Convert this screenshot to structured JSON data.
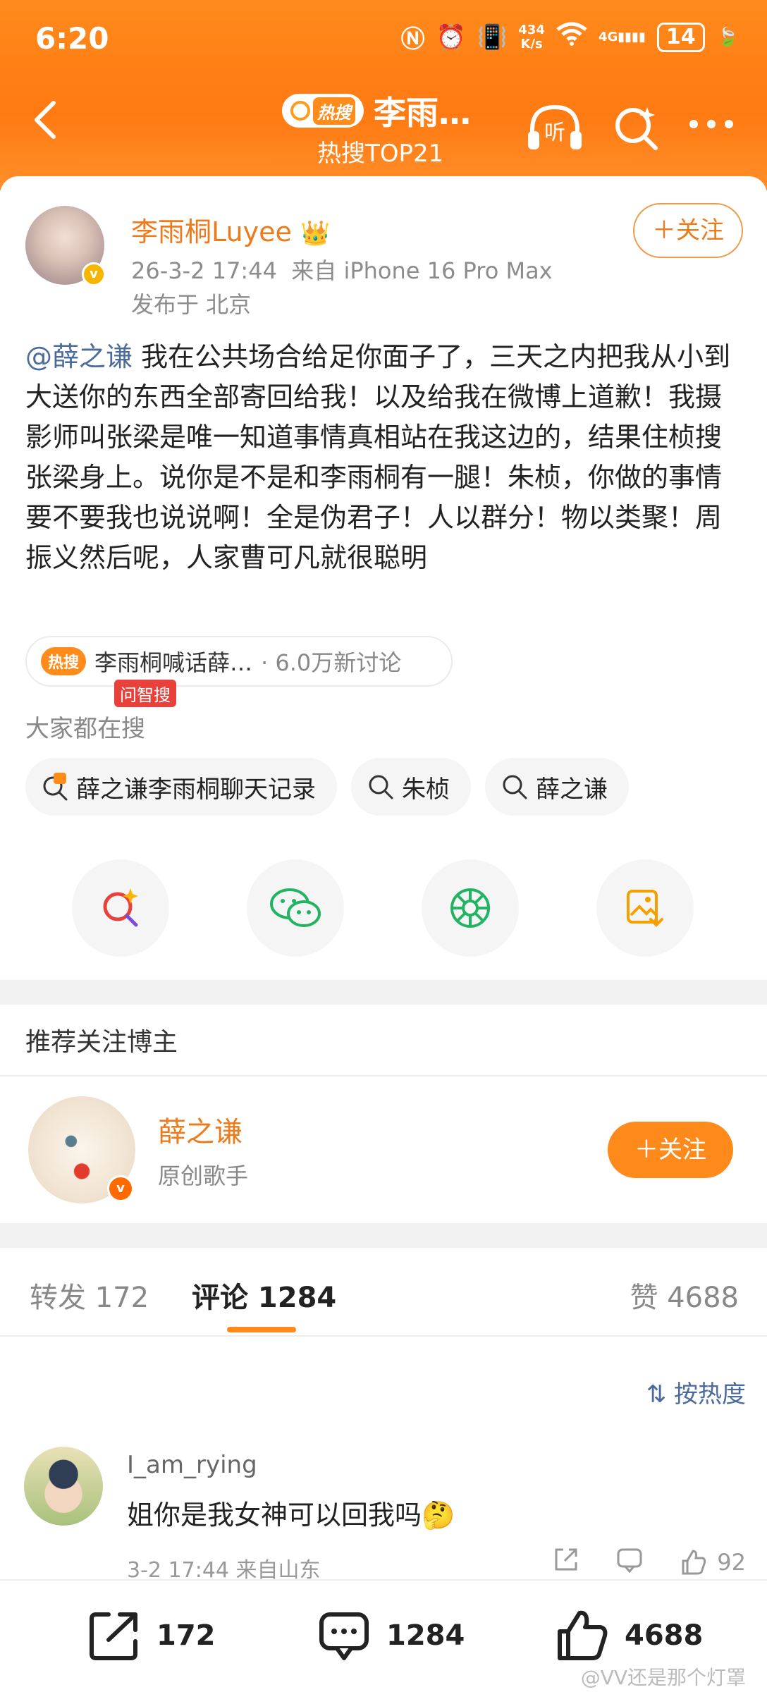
{
  "status_bar": {
    "time": "6:20",
    "net_speed_top": "434",
    "net_speed_unit": "K/s",
    "battery": "14",
    "signal": "4G"
  },
  "nav": {
    "hot_label": "热搜",
    "title": "李雨…",
    "subtitle": "热搜TOP21"
  },
  "post": {
    "author": "李雨桐Luyee",
    "timestamp": "26-3-2 17:44",
    "source": "来自 iPhone 16 Pro Max",
    "location": "发布于 北京",
    "follow_label": "＋关注",
    "mention": "@薛之谦",
    "body": " 我在公共场合给足你面子了，三天之内把我从小到大送你的东西全部寄回给我！以及给我在微博上道歉！我摄影师叫张梁是唯一知道事情真相站在我这边的，结果住桢搜张梁身上。说你是不是和李雨桐有一腿！朱桢，你做的事情要不要我也说说啊！全是伪君子！人以群分！物以类聚！周振义然后呢，人家曹可凡就很聪明",
    "topic_badge": "热搜",
    "topic_text": "李雨桐喊话薛…",
    "topic_count": "· 6.0万新讨论",
    "everyone_searching": "大家都在搜",
    "search_chips": [
      "薛之谦李雨桐聊天记录",
      "朱桢",
      "薛之谦"
    ],
    "ai_search_tag": "问智搜"
  },
  "recommend": {
    "title": "推荐关注博主",
    "name": "薛之谦",
    "desc": "原创歌手",
    "follow_label": "＋关注"
  },
  "comments": {
    "tabs": {
      "repost": "转发 172",
      "comment": "评论 1284",
      "like": "赞 4688"
    },
    "sort_label": "按热度",
    "first": {
      "user": "I_am_rying",
      "text": "姐你是我女神可以回我吗🤔",
      "meta": "3-2 17:44  来自山东",
      "likes": "92"
    }
  },
  "bottom_bar": {
    "repost": "172",
    "comment": "1284",
    "like": "4688"
  },
  "watermark": "@VV还是那个灯罩",
  "colors": {
    "brand_orange": "#ff8a1c",
    "link_blue": "#4a6b9c",
    "name_orange": "#ee7b1b"
  }
}
